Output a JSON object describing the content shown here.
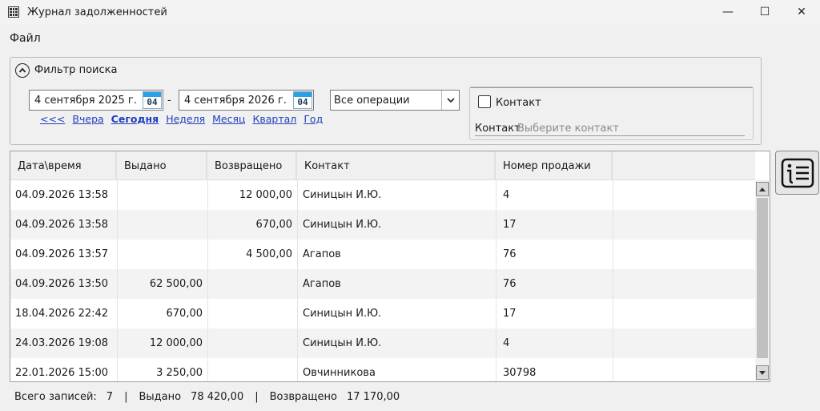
{
  "window": {
    "title": "Журнал задолженностей",
    "minimize": "—",
    "maximize": "☐",
    "close": "✕"
  },
  "menu": {
    "file": "Файл"
  },
  "filter": {
    "title": "Фильтр поиска",
    "date_from": "4 сентября 2025 г.",
    "date_to": "4 сентября 2026 г.",
    "cal_day": "04",
    "dash": "-",
    "quick_links": [
      "<<<",
      "Вчера",
      "Сегодня",
      "Неделя",
      "Месяц",
      "Квартал",
      "Год"
    ],
    "active_link": "Сегодня",
    "operation": "Все операции",
    "contact_check": "Контакт",
    "contact_tab": "Контакт",
    "contact_placeholder": "Выберите контакт"
  },
  "table": {
    "columns": [
      "Дата\\время",
      "Выдано",
      "Возвращено",
      "Контакт",
      "Номер продажи"
    ],
    "rows": [
      [
        "04.09.2026 13:58",
        "",
        "12 000,00",
        "Синицын И.Ю.",
        "4"
      ],
      [
        "04.09.2026 13:58",
        "",
        "670,00",
        "Синицын И.Ю.",
        "17"
      ],
      [
        "04.09.2026 13:57",
        "",
        "4 500,00",
        "Агапов",
        "76"
      ],
      [
        "04.09.2026 13:50",
        "62 500,00",
        "",
        "Агапов",
        "76"
      ],
      [
        "18.04.2026 22:42",
        "670,00",
        "",
        "Синицын И.Ю.",
        "17"
      ],
      [
        "24.03.2026 19:08",
        "12 000,00",
        "",
        "Синицын И.Ю.",
        "4"
      ],
      [
        "22.01.2026 15:00",
        "3 250,00",
        "",
        "Овчинникова",
        "30798"
      ]
    ]
  },
  "status": {
    "total_label": "Всего записей:",
    "total_value": "7",
    "issued_label": "Выдано",
    "issued_value": "78 420,00",
    "returned_label": "Возвращено",
    "returned_value": "17 170,00",
    "sep": "|"
  },
  "colors": {
    "link": "#1f3fbf",
    "calendar": "#2aa0e6"
  }
}
